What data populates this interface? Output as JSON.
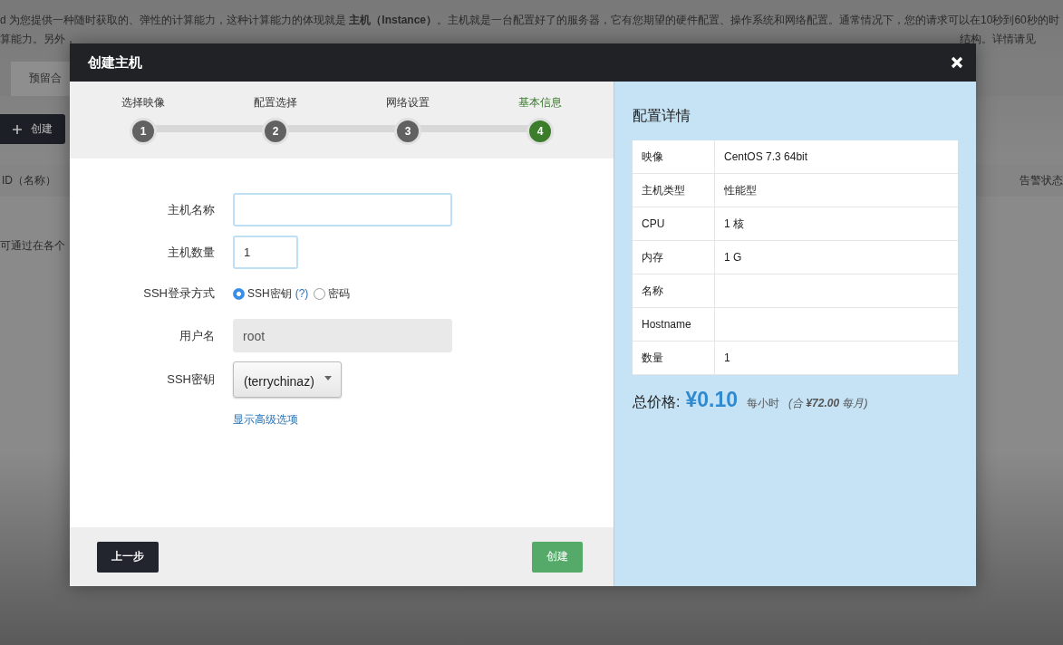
{
  "page": {
    "intro_lines": [
      "d 为您提供一种随时获取的、弹性的计算能力，这种计算能力的体现就是 **主机（Instance）**。主机就是一台配置好了的服务器，它有您期望的硬件配置、操作系统和网络配置。通常情况下，您的请求可以在10秒到60秒的时"
    ],
    "intro_left": "算能力。另外，",
    "intro_right": "结构。详情请见",
    "tabs": [
      "预留合"
    ],
    "create_button": "创建",
    "columns": [
      "ID（名称）",
      "告警状态"
    ],
    "empty_hint": "可通过在各个"
  },
  "dialog": {
    "title": "创建主机",
    "steps": [
      {
        "label": "选择映像",
        "number": "1",
        "selected": false
      },
      {
        "label": "配置选择",
        "number": "2",
        "selected": false
      },
      {
        "label": "网络设置",
        "number": "3",
        "selected": false
      },
      {
        "label": "基本信息",
        "number": "4",
        "selected": true
      }
    ],
    "form": {
      "name_label": "主机名称",
      "count_label": "主机数量",
      "count_value": "1",
      "login_label": "SSH登录方式",
      "login_options": [
        {
          "label": "SSH密钥",
          "help": "(?)",
          "selected": true
        },
        {
          "label": "密码",
          "selected": false
        }
      ],
      "user_label": "用户名",
      "user_value": "root",
      "key_label": "SSH密钥",
      "key_value": "(terrychinaz)",
      "advanced_link": "显示高级选项"
    },
    "back_button": "上一步",
    "create_button": "创建",
    "summary": {
      "title": "配置详情",
      "rows": [
        {
          "key": "映像",
          "value": "CentOS 7.3 64bit"
        },
        {
          "key": "主机类型",
          "value": "性能型"
        },
        {
          "key": "CPU",
          "value": "1 核"
        },
        {
          "key": "内存",
          "value": "1 G"
        },
        {
          "key": "名称"
        },
        {
          "key": "Hostname"
        },
        {
          "key": "数量",
          "value": "1"
        }
      ],
      "price_label": "总价格:",
      "price": "¥0.10",
      "price_unit": "每小时",
      "monthly": "(合 **¥72.00** 每月)"
    }
  }
}
